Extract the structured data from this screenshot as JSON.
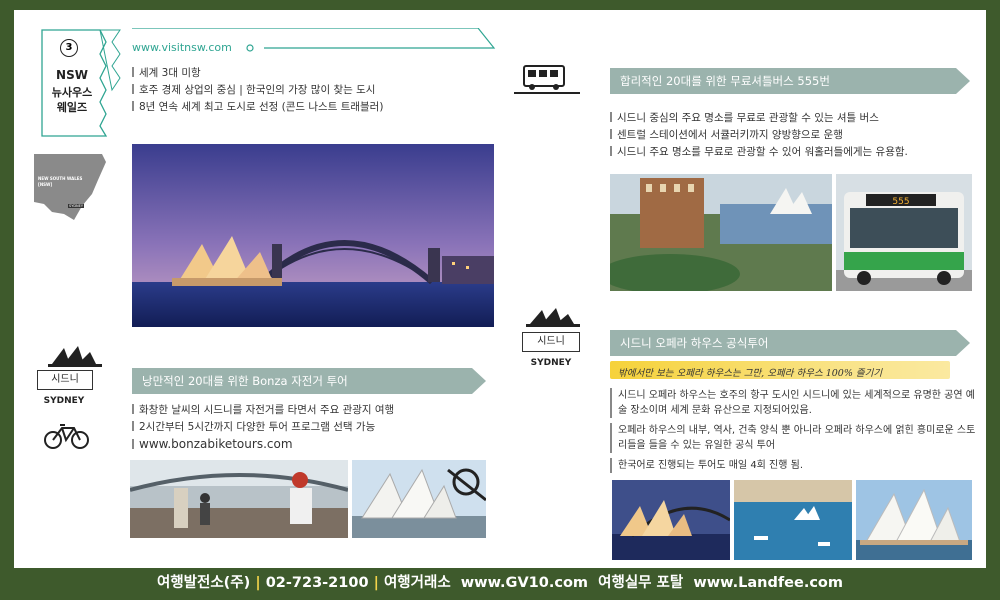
{
  "region": {
    "number": "3",
    "code": "NSW",
    "name_l1": "뉴사우스",
    "name_l2": "웨일즈",
    "map_label": "NEW SOUTH WALES [NSW]",
    "map_tag": "SYDNEY"
  },
  "website": "www.visitnsw.com",
  "intro_lines": [
    "세계 3대 미항",
    "호주 경제 상업의 중심  | 한국인의 가장 많이 찾는 도시",
    "8년 연속 세계 최고 도시로 선정 (콘드 나스트 트래블러)"
  ],
  "bike": {
    "title": "낭만적인 20대를 위한 Bonza 자전거 투어",
    "city": "시드니",
    "city_en": "SYDNEY",
    "lines": [
      "화창한 날씨의 시드니를 자전거를 타면서 주요 관광지 여행",
      "2시간부터 5시간까지 다양한 투어 프로그램 선택 가능",
      "www.bonzabiketours.com"
    ]
  },
  "shuttle": {
    "title": "합리적인 20대를 위한 무료셔틀버스 555번",
    "lines": [
      "시드니 중심의 주요 명소를 무료로 관광할 수 있는 셔틀 버스",
      "센트럴 스테이션에서 서큘러키까지 양방향으로 운행",
      "시드니 주요 명소를 무료로 관광할 수 있어 워홀러들에게는 유용함."
    ],
    "bus_sign": "555"
  },
  "opera": {
    "title": "시드니 오페라 하우스 공식투어",
    "city": "시드니",
    "city_en": "SYDNEY",
    "tagline": "밖에서만 보는 오페라 하우스는 그만, 오페라 하우스 100% 즐기기",
    "para1": "시드니 오페라 하우스는 호주의 항구 도시인 시드니에 있는 세계적으로 유명한 공연 예술 장소이며 세계 문화 유산으로 지정되어있음.",
    "para2": "오페라 하우스의 내부, 역사, 건축 양식 뿐 아니라 오페라 하우스에 얽힌 흥미로운 스토리들을 들을 수 있는 유일한 공식 투어",
    "para3": "한국어로 진행되는 투어도 매일 4회 진행 됨."
  },
  "footer": {
    "company": "여행발전소(주)",
    "phone": "02-723-2100",
    "agency": "여행거래소",
    "site1": "www.GV10.com",
    "portal": "여행실무 포탈",
    "site2": "www.Landfee.com"
  },
  "colors": {
    "banner": "#9bb3ad",
    "accent": "#2fa592",
    "frame": "#3e5a2c"
  }
}
